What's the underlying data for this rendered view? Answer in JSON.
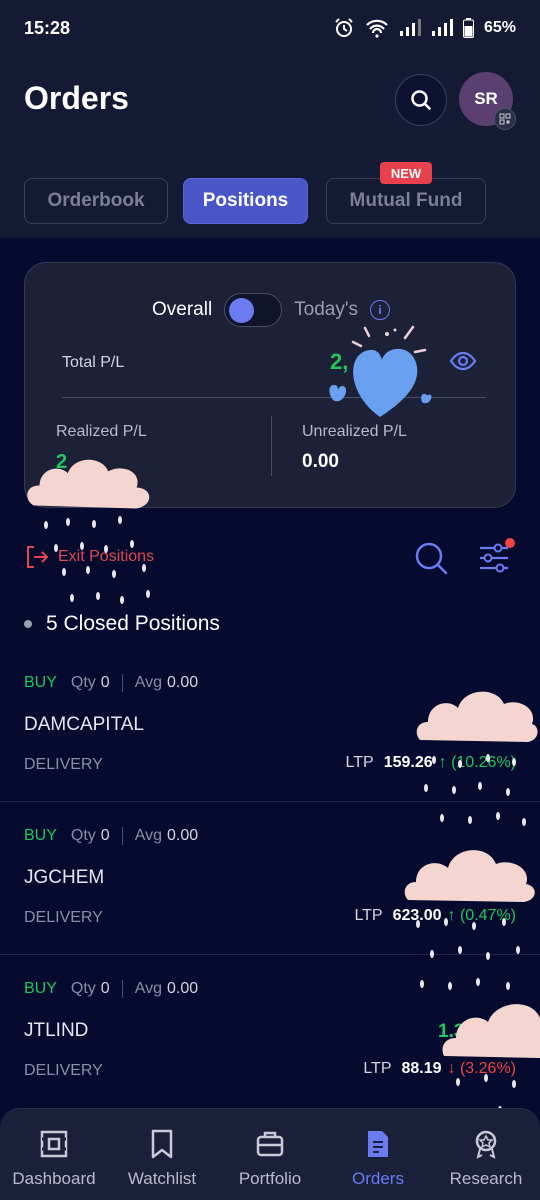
{
  "status_bar": {
    "time": "15:28",
    "battery": "65%"
  },
  "header": {
    "title": "Orders",
    "avatar_initials": "SR"
  },
  "tabs": [
    {
      "label": "Orderbook",
      "active": false
    },
    {
      "label": "Positions",
      "active": true
    },
    {
      "label": "Mutual Fund",
      "active": false,
      "badge": "NEW"
    }
  ],
  "summary": {
    "toggle_left": "Overall",
    "toggle_right": "Today's",
    "total_pl_label": "Total P/L",
    "total_pl_value": "2,",
    "realized_label": "Realized P/L",
    "realized_value": "2",
    "unrealized_label": "Unrealized P/L",
    "unrealized_value": "0.00"
  },
  "actions": {
    "exit_positions": "Exit Positions"
  },
  "closed_positions_label": "5 Closed Positions",
  "positions": [
    {
      "side": "BUY",
      "qty_label": "Qty",
      "qty": "0",
      "avg_label": "Avg",
      "avg": "0.00",
      "symbol": "DAMCAPITAL",
      "product": "DELIVERY",
      "ltp_label": "LTP",
      "ltp": "159.26",
      "change": "↑ (10.26%)",
      "direction": "up"
    },
    {
      "side": "BUY",
      "qty_label": "Qty",
      "qty": "0",
      "avg_label": "Avg",
      "avg": "0.00",
      "symbol": "JGCHEM",
      "product": "DELIVERY",
      "ltp_label": "LTP",
      "ltp": "623.00",
      "change": "↑ (0.47%)",
      "direction": "up"
    },
    {
      "side": "BUY",
      "qty_label": "Qty",
      "qty": "0",
      "avg_label": "Avg",
      "avg": "0.00",
      "symbol": "JTLIND",
      "product": "DELIVERY",
      "ltp_label": "LTP",
      "ltp": "88.19",
      "change": "↓ (3.26%)",
      "direction": "down",
      "partial_value": "1.3"
    }
  ],
  "bottom_nav": [
    {
      "label": "Dashboard",
      "icon": "dashboard-icon",
      "active": false
    },
    {
      "label": "Watchlist",
      "icon": "bookmark-icon",
      "active": false
    },
    {
      "label": "Portfolio",
      "icon": "briefcase-icon",
      "active": false
    },
    {
      "label": "Orders",
      "icon": "document-icon",
      "active": true
    },
    {
      "label": "Research",
      "icon": "award-icon",
      "active": false
    }
  ],
  "colors": {
    "accent": "#4a55c8",
    "profit": "#22c55e",
    "loss": "#ef4444",
    "background": "#050a2e"
  }
}
